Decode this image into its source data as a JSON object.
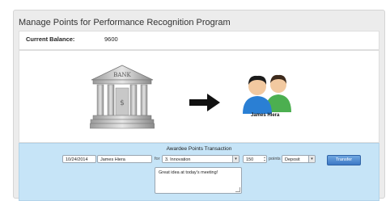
{
  "header": {
    "title": "Manage Points for Performance Recognition Program"
  },
  "balance": {
    "label": "Current Balance:",
    "value": "9600"
  },
  "illustration": {
    "bank_sign": "BANK",
    "awardee_name": "James Hiera",
    "icons": [
      "bank-building-icon",
      "right-arrow-icon",
      "people-icon"
    ]
  },
  "transaction": {
    "title": "Awardee Points Transaction",
    "date": "10/24/2014",
    "awardee": "James Hiera",
    "for_label": "for",
    "category": "3. Innovation",
    "points": "150",
    "points_label": "points",
    "type": "Deposit",
    "button_label": "Transfer",
    "note": "Great idea at today's meeting!"
  },
  "colors": {
    "panel_bg": "#ececec",
    "transaction_bg": "#c6e4f7",
    "button": "#3c78c5",
    "person_blue": "#2a7fd4",
    "person_green": "#4caf50"
  }
}
